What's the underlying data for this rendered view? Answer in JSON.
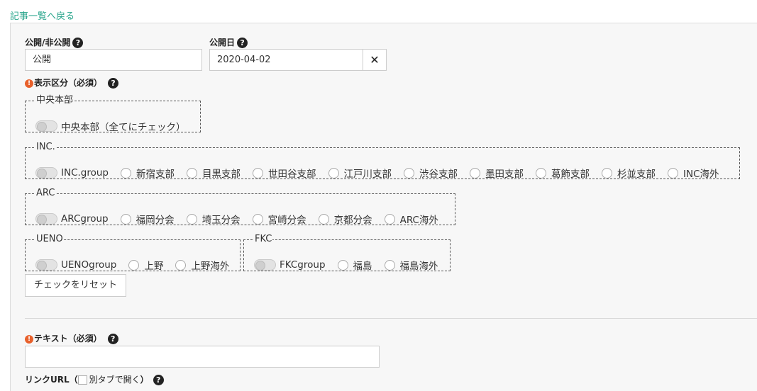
{
  "back_link": "記事一覧へ戻る",
  "publish": {
    "label": "公開/非公開",
    "value": "公開"
  },
  "publish_date": {
    "label": "公開日",
    "value": "2020-04-02",
    "clear": "✕"
  },
  "display_section": {
    "label": "表示区分（必須）"
  },
  "groups": {
    "chuo": {
      "legend": "中央本部",
      "toggle_label": "中央本部（全てにチェック）",
      "options": []
    },
    "inc": {
      "legend": "INC.",
      "toggle_label": "INC.group",
      "options": [
        "新宿支部",
        "目黒支部",
        "世田谷支部",
        "江戸川支部",
        "渋谷支部",
        "墨田支部",
        "葛飾支部",
        "杉並支部",
        "INC海外"
      ]
    },
    "arc": {
      "legend": "ARC",
      "toggle_label": "ARCgroup",
      "options": [
        "福岡分会",
        "埼玉分会",
        "宮崎分会",
        "京都分会",
        "ARC海外"
      ]
    },
    "ueno": {
      "legend": "UENO",
      "toggle_label": "UENOgroup",
      "options": [
        "上野",
        "上野海外"
      ]
    },
    "fkc": {
      "legend": "FKC",
      "toggle_label": "FKCgroup",
      "options": [
        "福島",
        "福島海外"
      ]
    }
  },
  "reset_button": "チェックをリセット",
  "text_field": {
    "label": "テキスト（必須）",
    "value": ""
  },
  "link_url": {
    "label_prefix": "リンクURL（",
    "checkbox_label": "別タブで開く",
    "label_suffix": "）"
  },
  "icons": {
    "help": "question-circle-icon",
    "required": "exclamation-circle-icon",
    "clear": "times-icon"
  },
  "colors": {
    "link": "#2aa58c",
    "required": "#e8612c",
    "help": "#222222"
  }
}
